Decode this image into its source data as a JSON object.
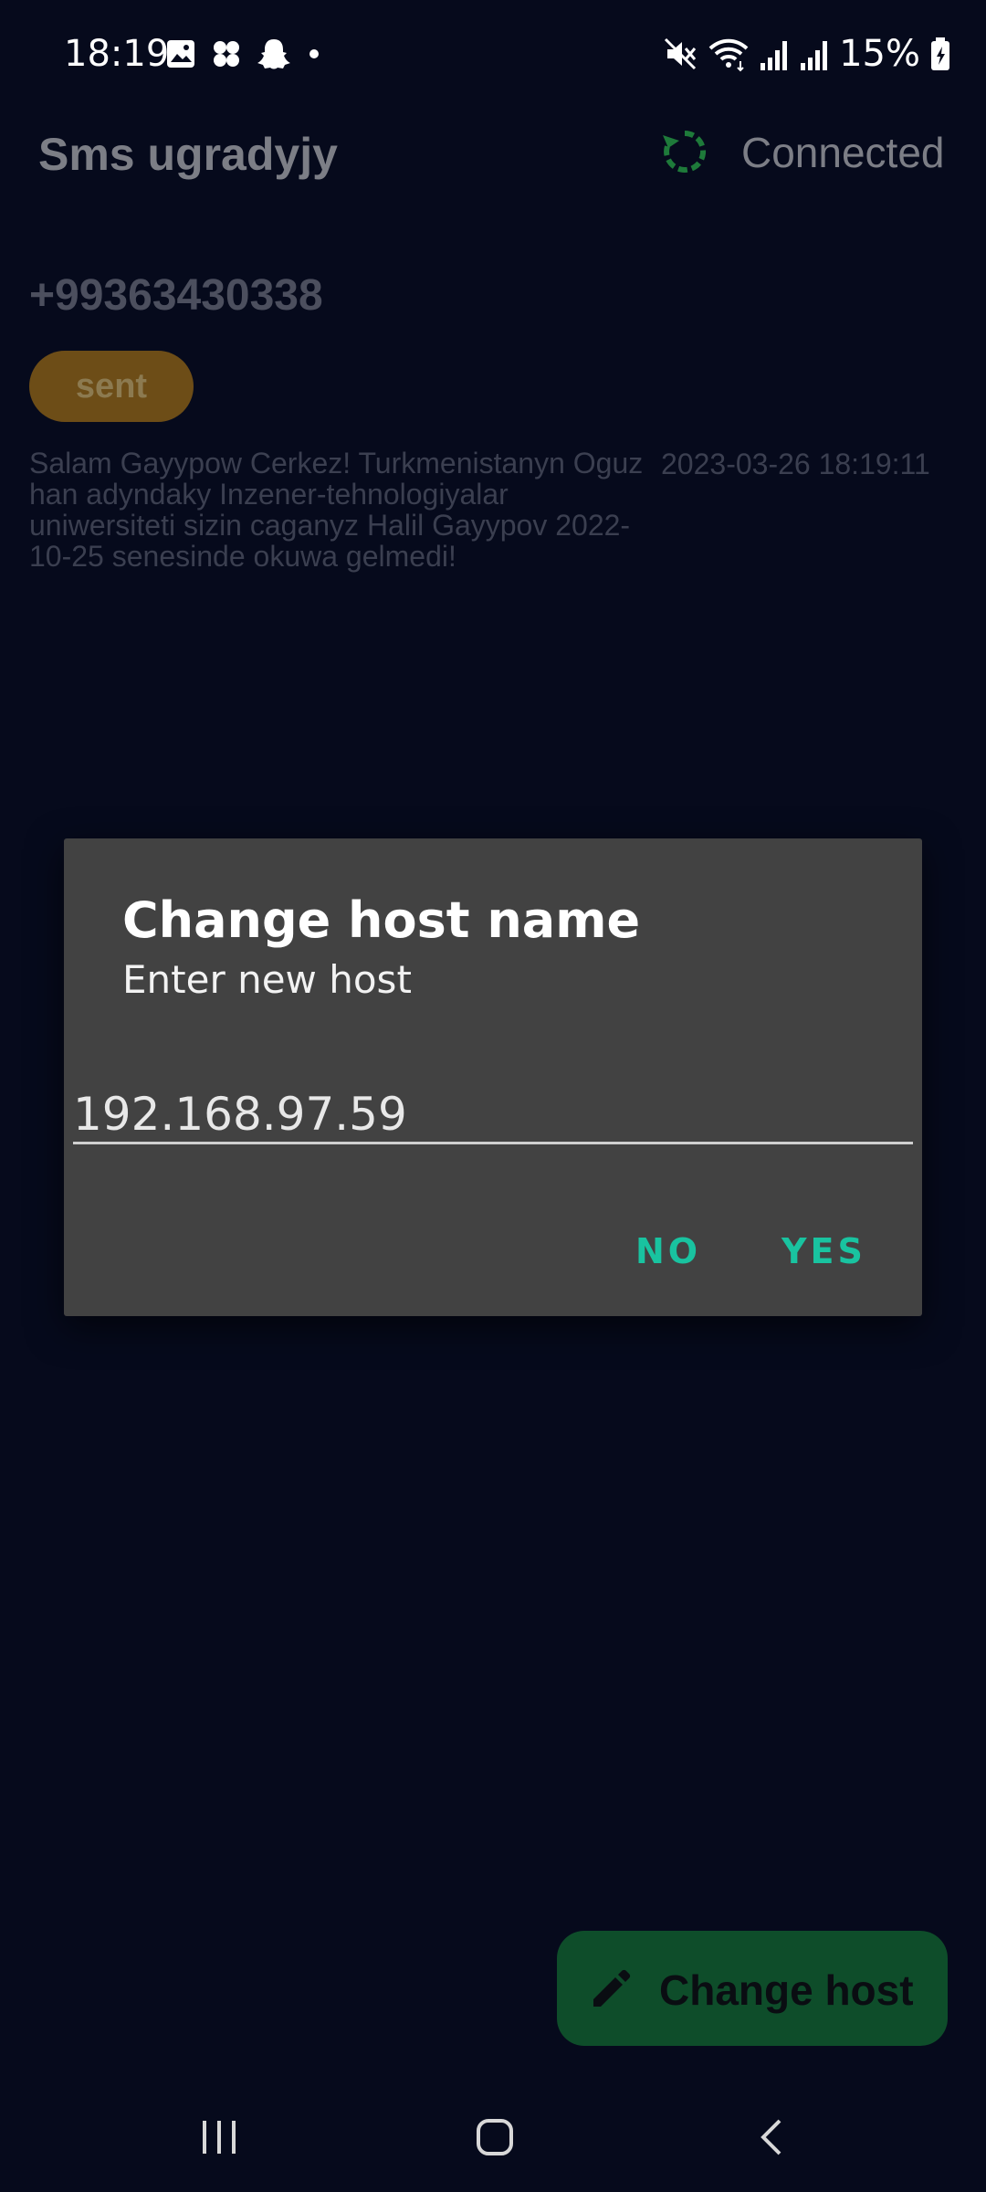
{
  "status_bar": {
    "time": "18:19",
    "battery": "15%",
    "left_icons": [
      "image-icon",
      "pinwheel-icon",
      "snapchat-icon",
      "dot-icon"
    ],
    "right_icons": [
      "mute-icon",
      "wifi-icon",
      "signal-icon",
      "signal-icon",
      "battery-charging-icon"
    ]
  },
  "app_bar": {
    "title": "Sms ugradyjy",
    "status": "Connected",
    "status_icon": "refresh-icon",
    "status_icon_color": "#1e7a3a"
  },
  "message": {
    "phone": "+99363430338",
    "badge": "sent",
    "badge_color": "#6d4d17",
    "body": "Salam Gayypow Cerkez! Turkmenistanyn Oguz han adyndaky Inzener-tehnologiyalar uniwersiteti sizin caganyz Halil Gayypov 2022-10-25 senesinde okuwa gelmedi!",
    "timestamp": "2023-03-26 18:19:11"
  },
  "dialog": {
    "title": "Change host name",
    "message": "Enter new host",
    "input_value": "192.168.97.59",
    "no_label": "NO",
    "yes_label": "YES",
    "accent_color": "#19c3a0"
  },
  "fab": {
    "label": "Change host",
    "icon": "pencil-icon",
    "color": "#0e4d2a"
  },
  "nav_bar": {
    "buttons": [
      "recents-icon",
      "home-icon",
      "back-icon"
    ]
  }
}
